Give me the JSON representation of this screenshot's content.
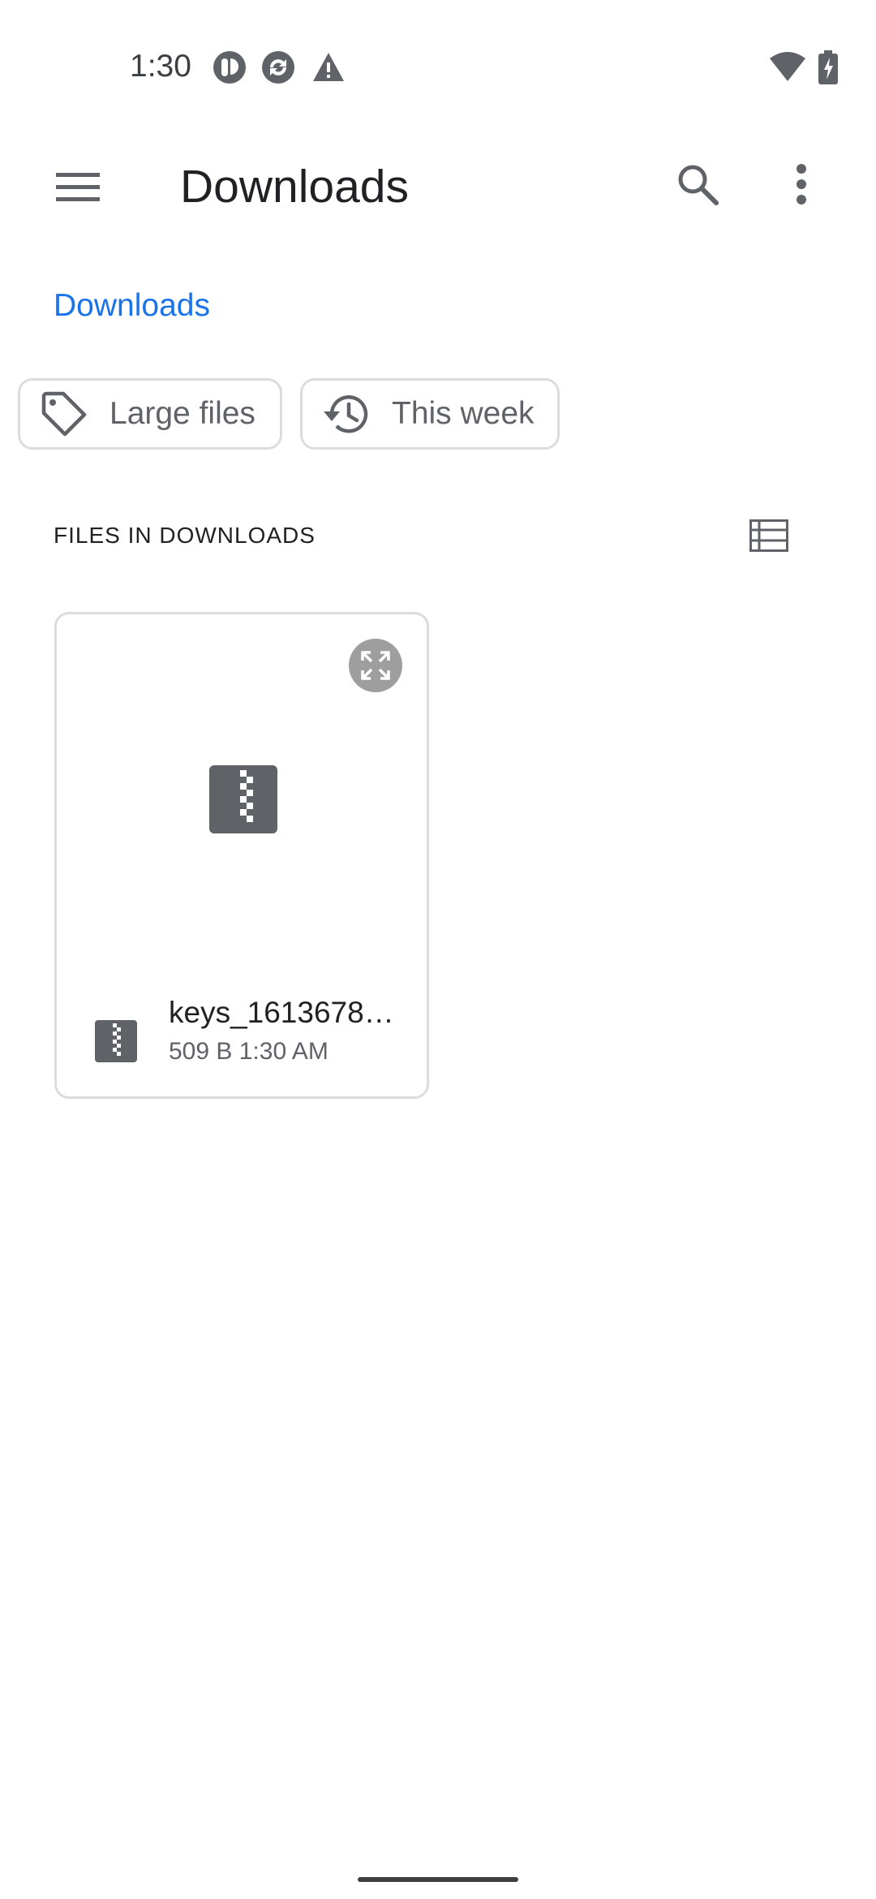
{
  "status_bar": {
    "time": "1:30",
    "left_icons": [
      "notification-icon",
      "sync-icon",
      "warning-icon"
    ],
    "right_icons": [
      "wifi-icon",
      "battery-charging-icon"
    ]
  },
  "app_bar": {
    "title": "Downloads",
    "menu_icon": "hamburger-menu-icon",
    "search_icon": "search-icon",
    "more_icon": "more-vert-icon"
  },
  "breadcrumb": {
    "label": "Downloads"
  },
  "filter_chips": [
    {
      "label": "Large files",
      "icon": "tag-icon"
    },
    {
      "label": "This week",
      "icon": "history-icon"
    }
  ],
  "section": {
    "title": "FILES IN DOWNLOADS",
    "view_toggle_icon": "list-view-icon"
  },
  "files": [
    {
      "name": "keys_1613678…",
      "size": "509 B",
      "time": "1:30 AM",
      "icon": "zip-file-icon"
    }
  ],
  "colors": {
    "accent": "#1a73e8",
    "text_primary": "#202124",
    "text_secondary": "#5f6368",
    "border": "#dadce0",
    "icon_dark": "#5f6368"
  }
}
